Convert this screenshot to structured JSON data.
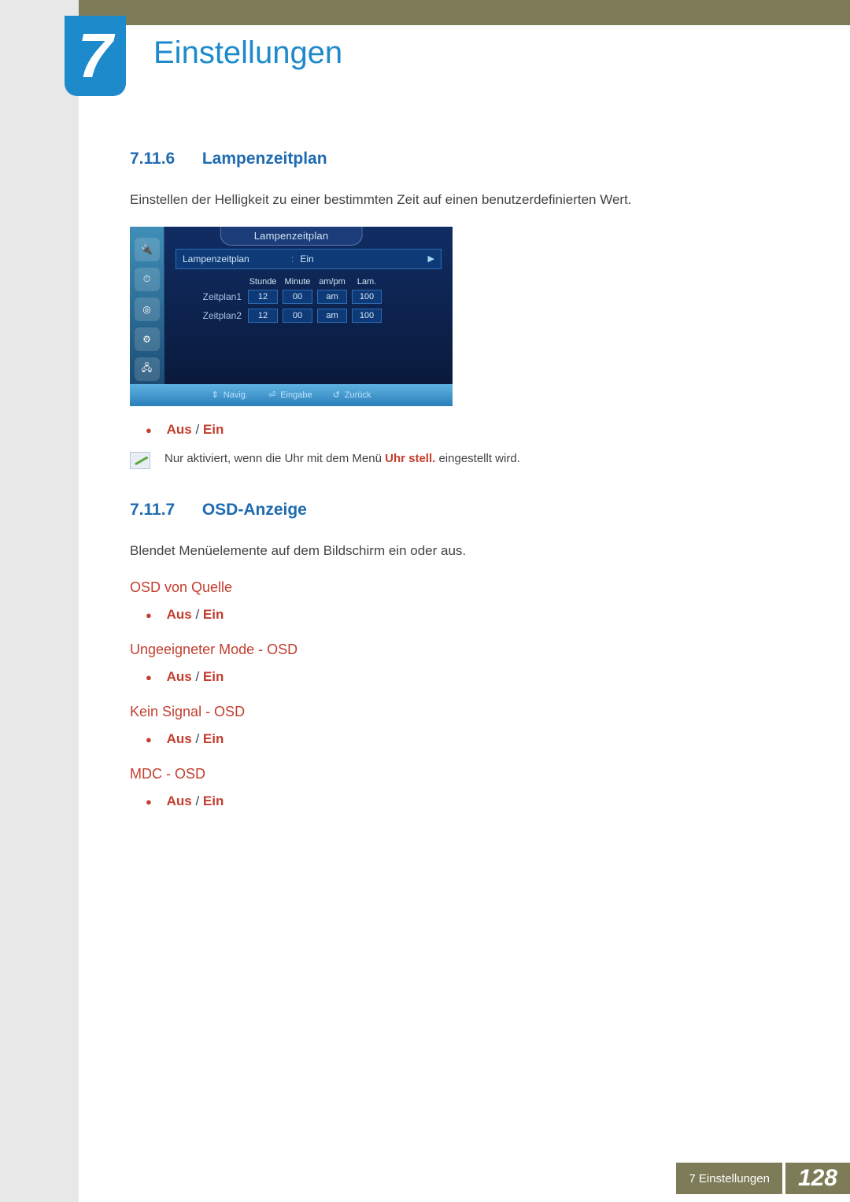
{
  "chapter": {
    "number": "7",
    "title": "Einstellungen"
  },
  "section1": {
    "num": "7.11.6",
    "title": "Lampenzeitplan",
    "body": "Einstellen der Helligkeit zu einer bestimmten Zeit auf einen benutzerdefinierten Wert.",
    "bullet": {
      "aus": "Aus",
      "sep": "/",
      "ein": "Ein"
    },
    "note_pre": "Nur aktiviert, wenn die Uhr mit dem Menü ",
    "note_hl": "Uhr stell.",
    "note_post": " eingestellt wird."
  },
  "osd": {
    "title": "Lampenzeitplan",
    "row1_label": "Lampenzeitplan",
    "row1_value": "Ein",
    "headers": {
      "h1": "Stunde",
      "h2": "Minute",
      "h3": "am/pm",
      "h4": "Lam."
    },
    "rows": [
      {
        "label": "Zeitplan1",
        "hour": "12",
        "min": "00",
        "ampm": "am",
        "lam": "100"
      },
      {
        "label": "Zeitplan2",
        "hour": "12",
        "min": "00",
        "ampm": "am",
        "lam": "100"
      }
    ],
    "footer": {
      "navig": "Navig.",
      "eingabe": "Eingabe",
      "zurueck": "Zurück"
    }
  },
  "section2": {
    "num": "7.11.7",
    "title": "OSD-Anzeige",
    "body": "Blendet Menüelemente auf dem Bildschirm ein oder aus.",
    "subs": [
      {
        "title": "OSD von Quelle",
        "aus": "Aus",
        "sep": "/",
        "ein": "Ein"
      },
      {
        "title": "Ungeeigneter Mode - OSD",
        "aus": "Aus",
        "sep": "/",
        "ein": "Ein"
      },
      {
        "title": "Kein Signal - OSD",
        "aus": "Aus",
        "sep": "/",
        "ein": "Ein"
      },
      {
        "title": "MDC - OSD",
        "aus": "Aus",
        "sep": "/",
        "ein": "Ein"
      }
    ]
  },
  "footer": {
    "label": "7 Einstellungen",
    "page": "128"
  }
}
